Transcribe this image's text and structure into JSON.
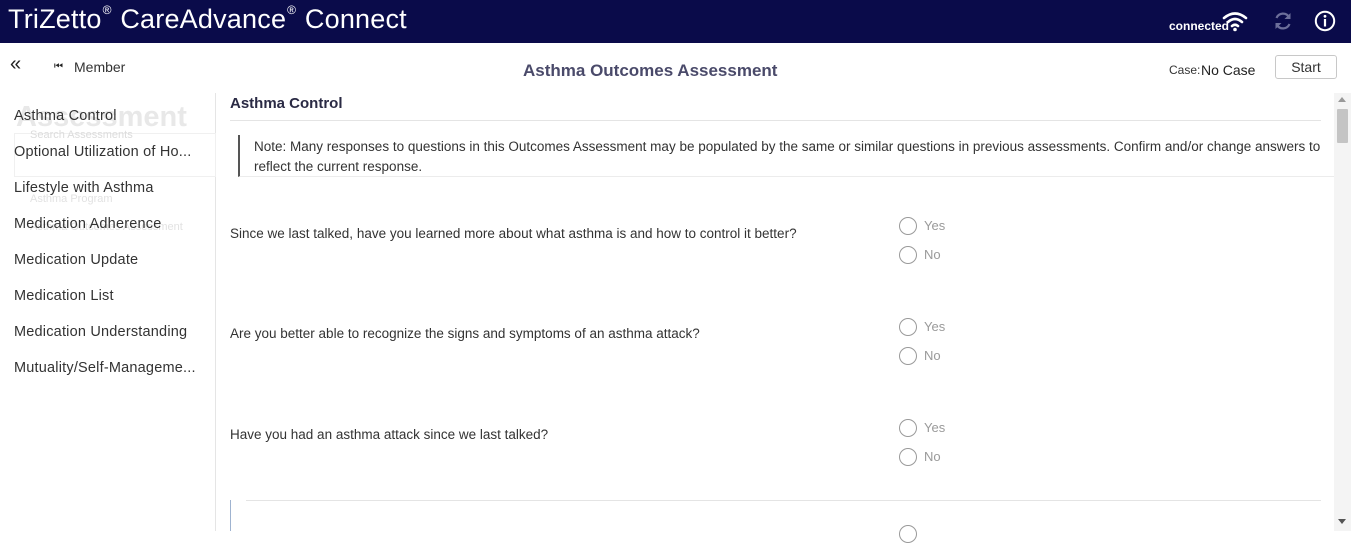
{
  "header": {
    "brand_part1": "TriZetto",
    "brand_part2": "CareAdvance",
    "brand_part3": "Connect",
    "brand_mark": "®",
    "status": "connected",
    "icons": [
      "wifi-icon",
      "sync-icon",
      "info-icon"
    ],
    "bg_color": "#0a0b4a"
  },
  "subheader": {
    "collapse_glyph": "«",
    "member_label": "Member",
    "title": "Asthma Outcomes Assessment",
    "case_label": "Case:",
    "case_value": "No Case",
    "start_label": "Start"
  },
  "sidebar": {
    "ghost_title": "Assessment",
    "ghost_search": "Search Assessments",
    "ghost_program": "Asthma Program",
    "ghost_program2": "Asthma Outcomes Assessment",
    "items": [
      "Asthma Control",
      "Optional Utilization of Ho...",
      "Lifestyle with Asthma",
      "Medication Adherence",
      "Medication Update",
      "Medication List",
      "Medication Understanding",
      "Mutuality/Self-Manageme..."
    ]
  },
  "main": {
    "section_title": "Asthma Control",
    "note": "Note: Many responses to questions in this Outcomes Assessment may be populated by the same or similar questions in previous assessments. Confirm and/or change answers to reflect the current response.",
    "questions": [
      {
        "text": "Since we last talked, have you learned more about what asthma is and how to control it better?",
        "options": [
          "Yes",
          "No"
        ]
      },
      {
        "text": "Are you better able to recognize the signs and symptoms of an asthma attack?",
        "options": [
          "Yes",
          "No"
        ]
      },
      {
        "text": "Have you had an asthma attack since we last talked?",
        "options": [
          "Yes",
          "No"
        ]
      }
    ]
  }
}
